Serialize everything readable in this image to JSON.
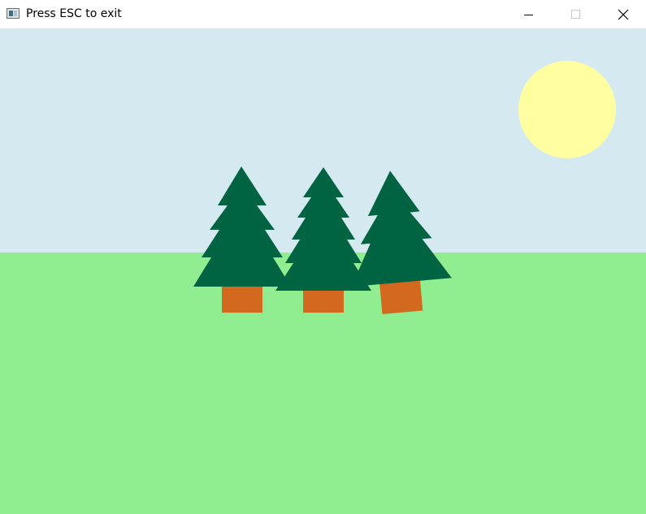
{
  "window": {
    "title": "Press ESC to exit",
    "icon": "app-window-icon",
    "controls": [
      {
        "name": "minimize-button",
        "icon": "minimize-icon"
      },
      {
        "name": "maximize-button",
        "icon": "maximize-icon"
      },
      {
        "name": "close-button",
        "icon": "close-icon"
      }
    ]
  },
  "scene": {
    "colors": {
      "sky": "#d5eaf0",
      "ground": "#90ee90",
      "sun": "#ffffa2",
      "foliage": "#006341",
      "trunk": "#d2691e"
    },
    "elements": [
      "sky",
      "ground",
      "sun",
      "tree-1",
      "tree-2",
      "tree-3"
    ]
  }
}
